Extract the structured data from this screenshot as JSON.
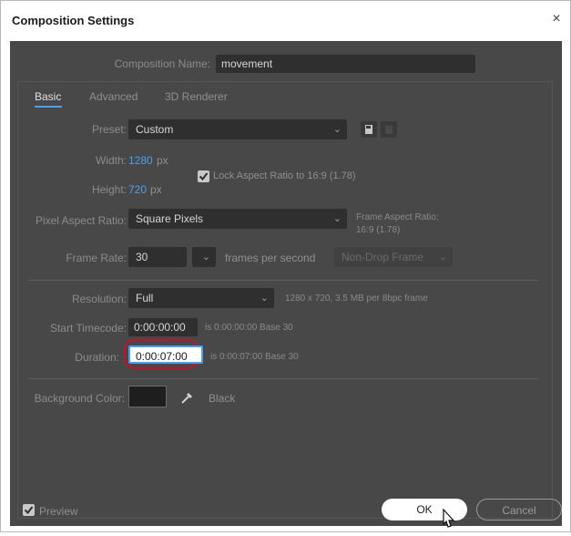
{
  "window": {
    "title": "Composition Settings",
    "close_glyph": "×"
  },
  "comp_name": {
    "label": "Composition Name:",
    "value": "movement"
  },
  "tabs": [
    {
      "label": "Basic",
      "active": true
    },
    {
      "label": "Advanced",
      "active": false
    },
    {
      "label": "3D Renderer",
      "active": false
    }
  ],
  "preset": {
    "label": "Preset:",
    "value": "Custom"
  },
  "width": {
    "label": "Width:",
    "value": "1280",
    "unit": "px"
  },
  "height": {
    "label": "Height:",
    "value": "720",
    "unit": "px"
  },
  "lock_aspect": {
    "label": "Lock Aspect Ratio to 16:9 (1.78)",
    "checked": true
  },
  "pixel_aspect": {
    "label": "Pixel Aspect Ratio:",
    "value": "Square Pixels",
    "frame_aspect_label": "Frame Aspect Ratio:",
    "frame_aspect_value": "16:9 (1.78)"
  },
  "frame_rate": {
    "label": "Frame Rate:",
    "value": "30",
    "unit": "frames per second",
    "drop_frame": "Non-Drop Frame"
  },
  "resolution": {
    "label": "Resolution:",
    "value": "Full",
    "info": "1280 x 720, 3.5 MB per 8bpc frame"
  },
  "start_timecode": {
    "label": "Start Timecode:",
    "value": "0:00:00:00",
    "info": "is 0:00:00:00  Base 30"
  },
  "duration": {
    "label": "Duration:",
    "value": "0:00:07:00",
    "info": "is 0:00:07:00  Base 30"
  },
  "background": {
    "label": "Background Color:",
    "color": "#1e1e1e",
    "name": "Black"
  },
  "footer": {
    "preview_label": "Preview",
    "preview_checked": true,
    "ok_label": "OK",
    "cancel_label": "Cancel"
  },
  "colors": {
    "panel": "#484848",
    "field": "#2f2f2f",
    "accent_blue": "#4e9ef0",
    "highlight_red": "#c8102e"
  }
}
